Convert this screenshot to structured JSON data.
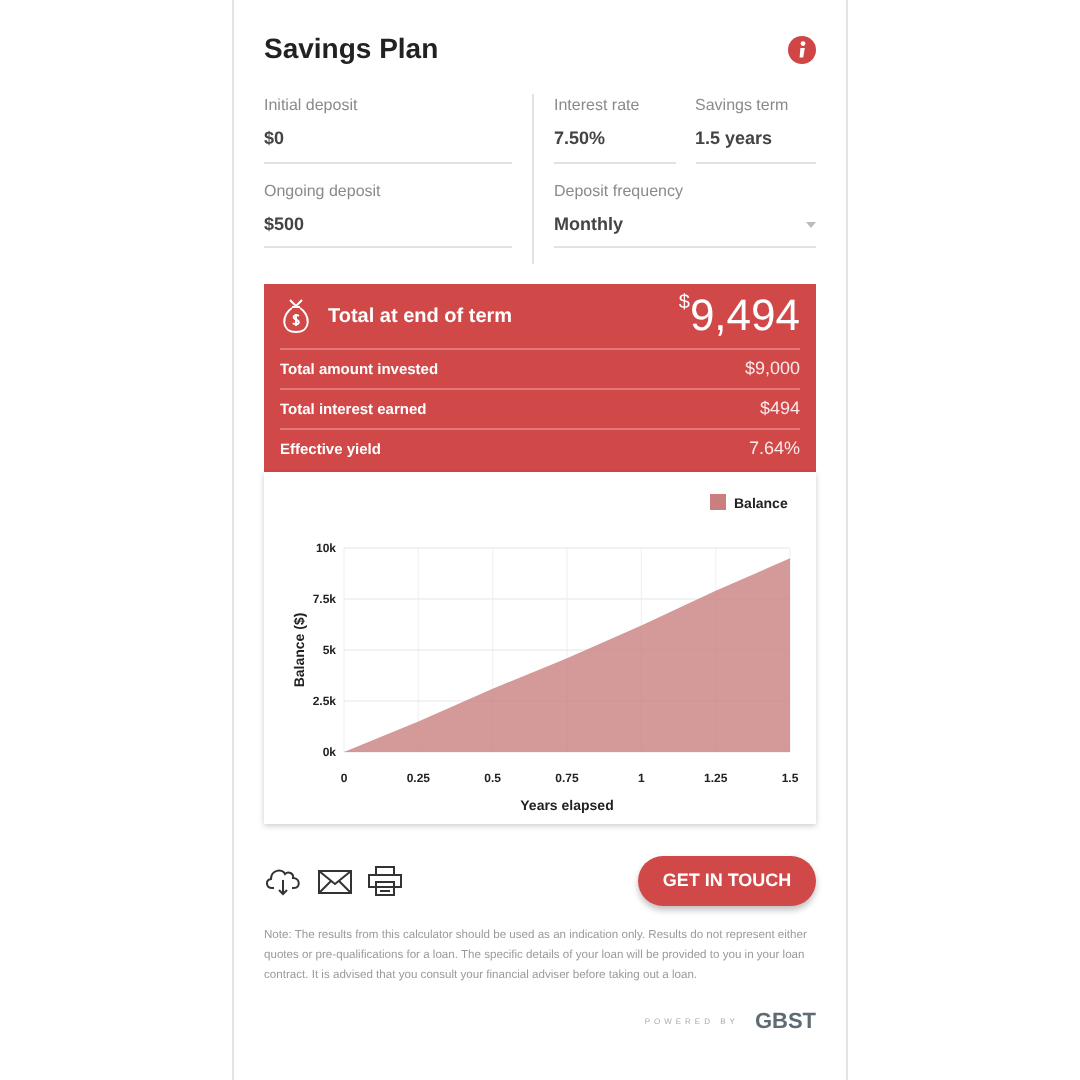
{
  "title": "Savings Plan",
  "fields": [
    {
      "label": "Initial deposit",
      "value": "$0",
      "kind": "text"
    },
    {
      "label": "Interest rate",
      "value": "7.50%",
      "kind": "text"
    },
    {
      "label": "Savings term",
      "value": "1.5 years",
      "kind": "text"
    },
    {
      "label": "Ongoing deposit",
      "value": "$500",
      "kind": "text"
    },
    {
      "label": "Deposit frequency",
      "value": "Monthly",
      "kind": "select"
    }
  ],
  "summary": {
    "heading": "Total at end of term",
    "currency": "$",
    "total": "9,494",
    "rows": [
      {
        "label": "Total amount invested",
        "value": "$9,000"
      },
      {
        "label": "Total interest earned",
        "value": "$494"
      },
      {
        "label": "Effective yield",
        "value": "7.64%"
      }
    ]
  },
  "chart_data": {
    "type": "area",
    "xlabel": "Years elapsed",
    "ylabel": "Balance ($)",
    "x": [
      0,
      0.25,
      0.5,
      0.75,
      1,
      1.25,
      1.5
    ],
    "series": [
      {
        "name": "Balance",
        "color": "#c97f7f",
        "values": [
          0,
          1500,
          3100,
          4600,
          6200,
          7900,
          9494
        ]
      }
    ],
    "grid": true,
    "xlim": [
      0,
      1.5
    ],
    "ylim": [
      0,
      10000
    ],
    "xticks": [
      0,
      0.25,
      0.5,
      0.75,
      1,
      1.25,
      1.5
    ],
    "yticks": [
      {
        "value": 0,
        "label": "0k"
      },
      {
        "value": 2500,
        "label": "2.5k"
      },
      {
        "value": 5000,
        "label": "5k"
      },
      {
        "value": 7500,
        "label": "7.5k"
      },
      {
        "value": 10000,
        "label": "10k"
      }
    ]
  },
  "cta": "GET IN TOUCH",
  "note": "Note: The results from this calculator should be used as an indication only. Results do not represent either quotes or pre-qualifications for a loan. The specific details of your loan will be provided to you in your loan contract. It is advised that you consult your financial adviser before taking out a loan.",
  "powered_by": "POWERED BY",
  "brand": "GBST"
}
